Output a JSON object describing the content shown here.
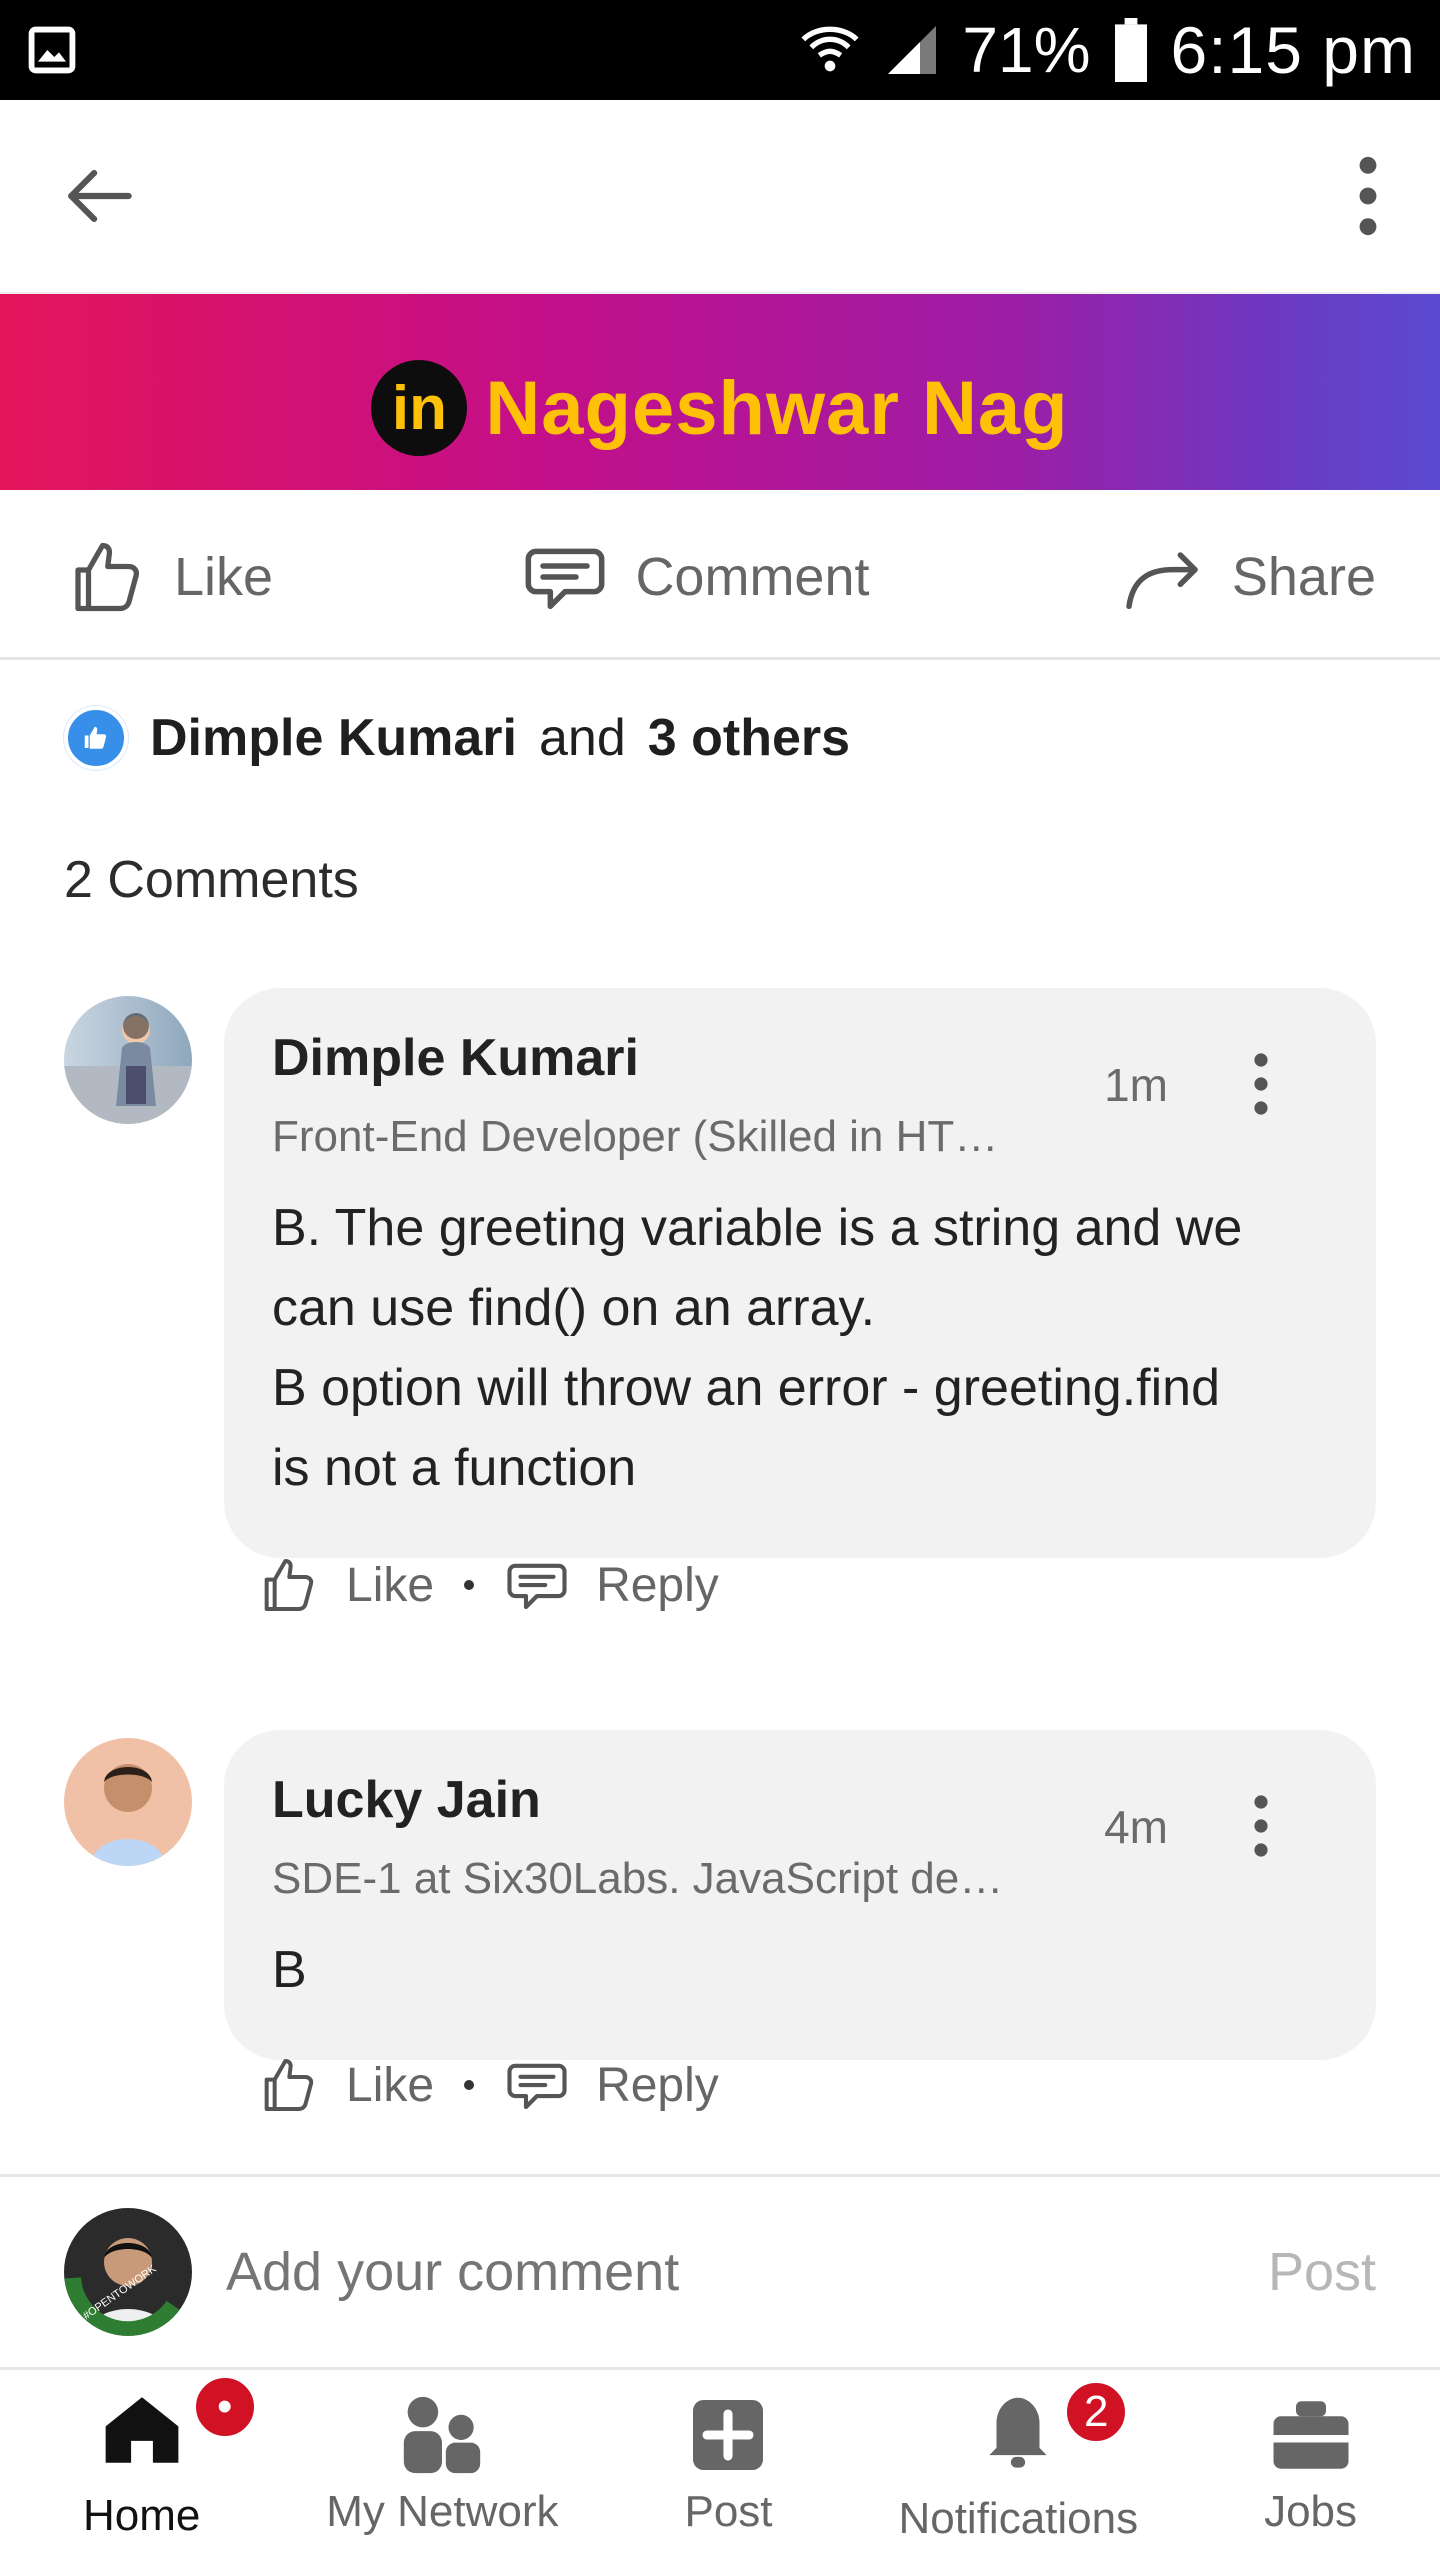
{
  "status_bar": {
    "battery": "71%",
    "time": "6:15 pm"
  },
  "header": {
    "author": "Nageshwar Nag",
    "logo_text": "in"
  },
  "actions": {
    "like": "Like",
    "comment": "Comment",
    "share": "Share"
  },
  "reactions": {
    "name": "Dimple Kumari",
    "middle": "and",
    "others": "3 others"
  },
  "comments_section": {
    "count_label": "2 Comments",
    "items": [
      {
        "name": "Dimple Kumari",
        "subtitle": "Front-End Developer (Skilled in HT…",
        "time": "1m",
        "text_lines": [
          "B. The greeting variable is a string and we",
          "can use find() on an array.",
          "B option will throw an error - greeting.find",
          "is not a function"
        ],
        "like": "Like",
        "reply": "Reply"
      },
      {
        "name": "Lucky Jain",
        "subtitle": "SDE-1 at Six30Labs. JavaScript de…",
        "time": "4m",
        "text_lines": [
          "B"
        ],
        "like": "Like",
        "reply": "Reply"
      }
    ]
  },
  "composer": {
    "placeholder": "Add your comment",
    "post": "Post",
    "avatar_badge": "#OPENTOWORK"
  },
  "bottom_nav": {
    "items": [
      {
        "label": "Home",
        "badge": "•"
      },
      {
        "label": "My Network"
      },
      {
        "label": "Post"
      },
      {
        "label": "Notifications",
        "badge": "2"
      },
      {
        "label": "Jobs"
      }
    ]
  },
  "colors": {
    "accent": "#0a66c2",
    "badge": "#d11124",
    "banner_text": "#ffc107"
  },
  "icons": {
    "back": "arrow-left-icon",
    "more": "more-vertical-icon",
    "like": "thumbs-up-icon",
    "comment": "speech-bubble-icon",
    "share": "share-arrow-icon",
    "home": "home-icon",
    "network": "people-icon",
    "post": "plus-square-icon",
    "notifications": "bell-icon",
    "jobs": "briefcase-icon"
  }
}
